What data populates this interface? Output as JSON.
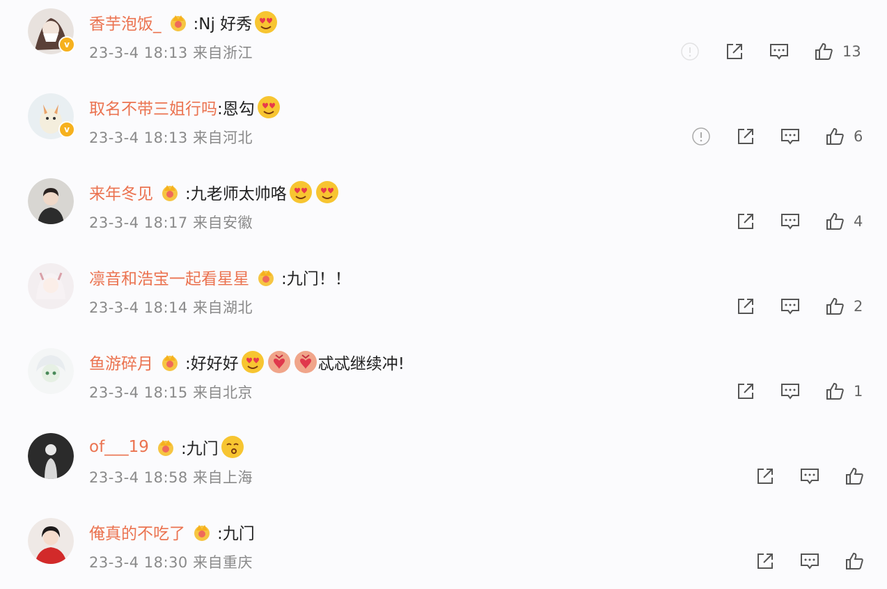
{
  "comments": [
    {
      "username": "香芋泡饭_",
      "text": ":Nj 好秀",
      "time": "23-3-4 18:13",
      "location": "来自浙江",
      "likes": "13",
      "emojis": [
        "heart-eyes"
      ],
      "verified": true,
      "crown": true,
      "report_icon": true
    },
    {
      "username": "取名不带三姐行吗",
      "text": ":恩勾",
      "time": "23-3-4 18:13",
      "location": "来自河北",
      "likes": "6",
      "emojis": [
        "heart-eyes"
      ],
      "verified": true,
      "crown": false,
      "report_icon": true
    },
    {
      "username": "来年冬见",
      "text": ":九老师太帅咯",
      "time": "23-3-4 18:17",
      "location": "来自安徽",
      "likes": "4",
      "emojis": [
        "heart-eyes",
        "heart-eyes"
      ],
      "verified": false,
      "crown": true,
      "report_icon": false
    },
    {
      "username": "凛音和浩宝一起看星星",
      "text": ":九门！！",
      "time": "23-3-4 18:14",
      "location": "来自湖北",
      "likes": "2",
      "emojis": [],
      "verified": false,
      "crown": true,
      "report_icon": false
    },
    {
      "username": "鱼游碎月",
      "text": ":好好好",
      "text2": "忒忒继续冲!",
      "time": "23-3-4 18:15",
      "location": "来自北京",
      "likes": "1",
      "emojis": [
        "heart-eyes",
        "gift-heart",
        "gift-heart"
      ],
      "verified": false,
      "crown": true,
      "report_icon": false
    },
    {
      "username": "of___19",
      "text": ":九门",
      "time": "23-3-4 18:58",
      "location": "来自上海",
      "likes": "",
      "emojis": [
        "kiss-face"
      ],
      "verified": false,
      "crown": true,
      "report_icon": false
    },
    {
      "username": "俺真的不吃了",
      "text": ":九门",
      "time": "23-3-4 18:30",
      "location": "来自重庆",
      "likes": "",
      "emojis": [],
      "verified": false,
      "crown": true,
      "report_icon": false
    }
  ],
  "colors": {
    "username": "#eb7350",
    "meta": "#8a8a8a",
    "icon": "#555555",
    "crown": "#f6b11e"
  }
}
